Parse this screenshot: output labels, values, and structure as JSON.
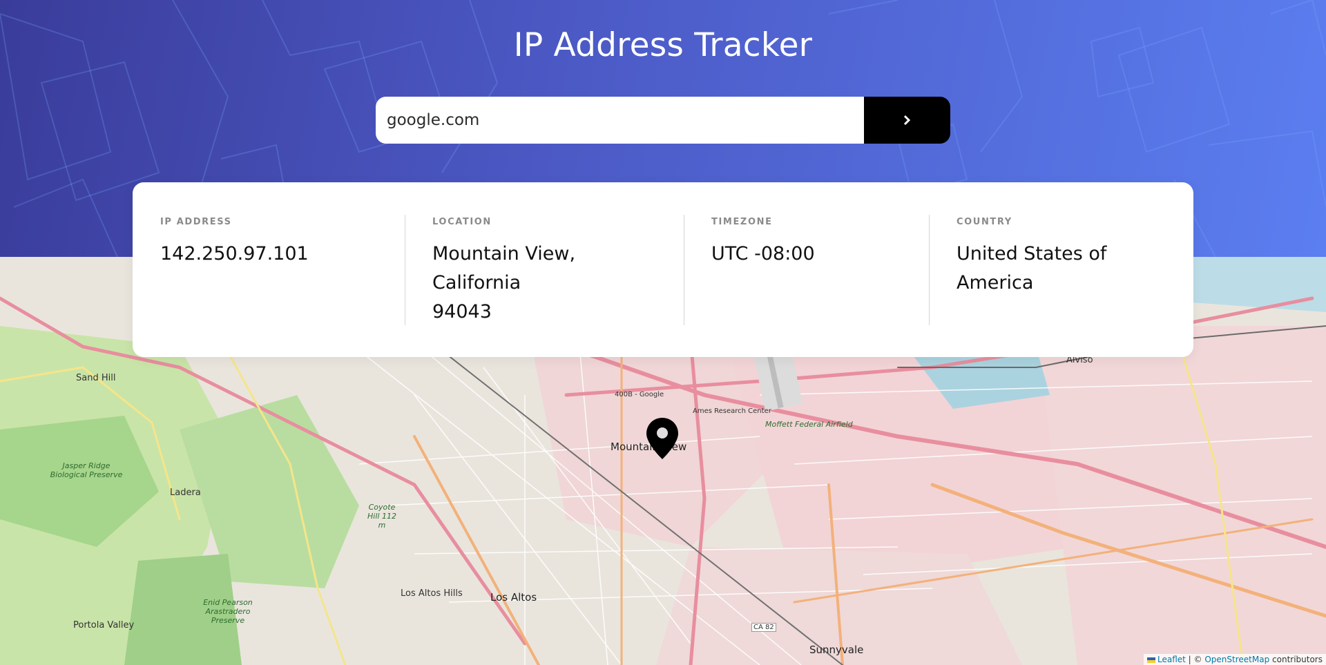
{
  "header": {
    "title": "IP Address Tracker",
    "search": {
      "value": "google.com",
      "button_icon": "chevron-right-icon"
    }
  },
  "info": {
    "ip": {
      "label": "IP ADDRESS",
      "value": "142.250.97.101"
    },
    "location": {
      "label": "LOCATION",
      "line1": "Mountain View,",
      "line2": "California",
      "line3": "94043"
    },
    "timezone": {
      "label": "TIMEZONE",
      "value": "UTC -08:00"
    },
    "country": {
      "label": "COUNTRY",
      "line1": "United States of",
      "line2": "America"
    }
  },
  "map": {
    "marker_icon": "location-pin-icon",
    "labels": {
      "mountain_view": "Mountain View",
      "los_altos": "Los Altos",
      "los_altos_hills": "Los Altos Hills",
      "sunnyvale": "Sunnyvale",
      "portola_valley": "Portola Valley",
      "ladera": "Ladera",
      "sand_hill": "Sand Hill",
      "alviso": "Alviso",
      "ames": "Ames Research Center",
      "moffett": "Moffett Federal Airfield",
      "jasper": "Jasper Ridge Biological Preserve",
      "enid": "Enid Pearson Arastradero Preserve",
      "coyote": "Coyote Hill 112 m",
      "google": "400B - Google",
      "ca82": "CA 82"
    },
    "attribution": {
      "leaflet": "Leaflet",
      "separator": " | © ",
      "osm": "OpenStreetMap",
      "suffix": " contributors"
    }
  },
  "colors": {
    "accent": "#000000",
    "hero_start": "#3a3c9a",
    "hero_end": "#5b7ef0"
  }
}
